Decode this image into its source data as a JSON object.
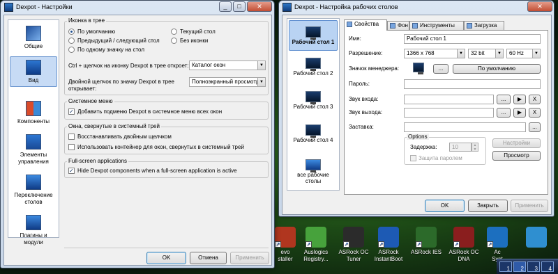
{
  "desktop": {
    "icons": [
      {
        "label": "Revo Uninstaller",
        "label_lines": [
          "evo",
          "staller"
        ],
        "color": "#b0361f"
      },
      {
        "label": "Auslogics Registry...",
        "label_lines": [
          "Auslogics",
          "Registry..."
        ],
        "color": "#47a23c"
      },
      {
        "label": "ASRock OC Tuner",
        "label_lines": [
          "ASRock OC",
          "Tuner"
        ],
        "color": "#2b2b2b"
      },
      {
        "label": "ASRock InstantBoot",
        "label_lines": [
          "ASRock",
          "InstantBoot"
        ],
        "color": "#1d5ab4"
      },
      {
        "label": "ASRock IES",
        "label_lines": [
          "ASRock IES",
          ""
        ],
        "color": "#2c6a2a"
      },
      {
        "label": "ASRock OC DNA",
        "label_lines": [
          "ASRock OC",
          "DNA"
        ],
        "color": "#8a1e1e"
      },
      {
        "label": "Ac... Syst...",
        "label_lines": [
          "Ac",
          "Syst"
        ],
        "color": "#1c6fbf"
      },
      {
        "label": "",
        "label_lines": [
          "",
          ""
        ],
        "color": "#2f8fd0"
      }
    ],
    "taskbar_desktops": [
      "1",
      "2",
      "3",
      "4"
    ]
  },
  "settings_window": {
    "title": "Dexpot - Настройки",
    "sidebar": [
      {
        "label": "Общие",
        "icon": "general-icon",
        "selected": false
      },
      {
        "label": "Вид",
        "icon": "view-icon",
        "selected": true
      },
      {
        "label": "Компоненты",
        "icon": "components-icon",
        "selected": false
      },
      {
        "label": "Элементы управления",
        "icon": "controls-icon",
        "selected": false
      },
      {
        "label": "Переключение столов",
        "icon": "switching-icon",
        "selected": false
      },
      {
        "label": "Плагины и модули",
        "icon": "plugins-icon",
        "selected": false
      }
    ],
    "tray_icon_group": {
      "title": "Иконка в трее",
      "radio_default": "По умолчанию",
      "radio_current": "Текущий стол",
      "radio_prevnext": "Предыдущий / следующий стол",
      "radio_none": "Без иконки",
      "radio_per_desk": "По одному значку на стол",
      "ctrl_click_label": "Ctrl + щелчок на иконку Dexpot в трее откроет:",
      "ctrl_click_value": "Каталог окон",
      "dbl_click_label_1": "Двойной щелчок по значку Dexpot в трее",
      "dbl_click_label_2": "открывает:",
      "dbl_click_value": "Полноэкранный просмотр"
    },
    "system_menu_group": {
      "title": "Системное меню",
      "add_submenu": "Добавить подменю Dexpot в системное меню всех окон"
    },
    "tray_windows_group": {
      "title": "Окна, свернутые в системный трей",
      "restore_dblclick": "Восстанавливать двойным щелчком",
      "use_container": "Использовать контейнер для окон, свернутых в системный трей"
    },
    "fullscreen_group": {
      "title": "Full-screen applications",
      "hide_components": "Hide Dexpot components when a full-screen application is active"
    },
    "buttons": {
      "ok": "OK",
      "cancel": "Отмена",
      "apply": "Применить"
    }
  },
  "desks_window": {
    "title": "Dexpot - Настройка рабочих столов",
    "desktops": [
      {
        "label": "Рабочий стол 1",
        "selected": true
      },
      {
        "label": "Рабочий стол 2",
        "selected": false
      },
      {
        "label": "Рабочий стол 3",
        "selected": false
      },
      {
        "label": "Рабочий стол 4",
        "selected": false
      },
      {
        "label": "все рабочие столы",
        "selected": false
      }
    ],
    "tabs": [
      {
        "label": "Свойства",
        "icon": "properties-icon",
        "active": true
      },
      {
        "label": "Фон",
        "icon": "background-icon",
        "active": false
      },
      {
        "label": "Инструменты",
        "icon": "tools-icon",
        "active": false
      },
      {
        "label": "Загрузка",
        "icon": "startup-icon",
        "active": false
      }
    ],
    "properties": {
      "name_label": "Имя:",
      "name_value": "Рабочий стол 1",
      "resolution_label": "Разрешение:",
      "resolution_value": "1366 x 768",
      "bits_value": "32 bit",
      "hz_value": "60 Hz",
      "manager_icon_label": "Значок менеджера:",
      "browse_label": "...",
      "default_label": "По умолчанию",
      "password_label": "Пароль:",
      "login_sound_label": "Звук входа:",
      "logout_sound_label": "Звук выхода:",
      "screensaver_label": "Заставка:",
      "play_label": "▶",
      "clear_label": "X",
      "options_title": "Options",
      "delay_label": "Задержка:",
      "delay_value": "10",
      "password_protected_label": "Защита паролем",
      "settings_button": "Настройки",
      "preview_button": "Просмотр"
    },
    "buttons": {
      "ok": "OK",
      "close": "Закрыть",
      "apply": "Применить"
    }
  }
}
